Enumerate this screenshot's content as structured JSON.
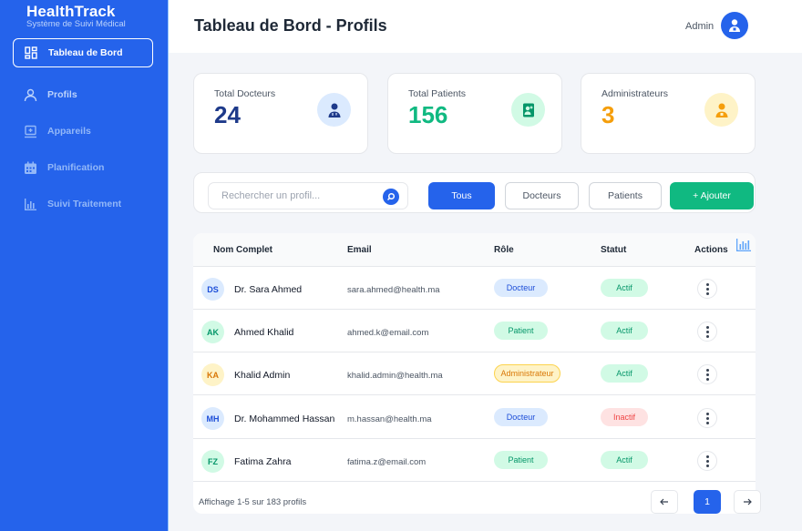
{
  "brand": {
    "title": "HealthTrack",
    "subtitle": "Système de Suivi Médical"
  },
  "sidebar": {
    "items": [
      {
        "label": "Tableau de Bord",
        "icon": "dashboard-icon",
        "active": true
      },
      {
        "label": "Profils",
        "icon": "user-icon"
      },
      {
        "label": "Appareils",
        "icon": "device-icon"
      },
      {
        "label": "Planification",
        "icon": "calendar-icon"
      },
      {
        "label": "Suivi Traitement",
        "icon": "chart-icon"
      }
    ]
  },
  "header": {
    "title": "Tableau de Bord - Profils",
    "user_label": "Admin"
  },
  "stats": [
    {
      "label": "Total Docteurs",
      "value": "24",
      "color": "#1e3a8a",
      "icon": "doctor-icon"
    },
    {
      "label": "Total Patients",
      "value": "156",
      "color": "#10b981",
      "icon": "patient-icon"
    },
    {
      "label": "Administrateurs",
      "value": "3",
      "color": "#f59e0b",
      "icon": "admin-icon"
    }
  ],
  "filters": {
    "search_placeholder": "Rechercher un profil...",
    "buttons": [
      "Tous",
      "Docteurs",
      "Patients"
    ],
    "add_label": "+ Ajouter"
  },
  "table": {
    "headers": [
      "Nom Complet",
      "Email",
      "Rôle",
      "Statut",
      "Actions"
    ],
    "rows": [
      {
        "initials": "DS",
        "name": "Dr. Sara Ahmed",
        "email": "sara.ahmed@health.ma",
        "role": "Docteur",
        "status": "Actif"
      },
      {
        "initials": "AK",
        "name": "Ahmed Khalid",
        "email": "ahmed.k@email.com",
        "role": "Patient",
        "status": "Actif"
      },
      {
        "initials": "KA",
        "name": "Khalid Admin",
        "email": "khalid.admin@health.ma",
        "role": "Administrateur",
        "status": "Actif"
      },
      {
        "initials": "MH",
        "name": "Dr. Mohammed Hassan",
        "email": "m.hassan@health.ma",
        "role": "Docteur",
        "status": "Inactif"
      },
      {
        "initials": "FZ",
        "name": "Fatima Zahra",
        "email": "fatima.z@email.com",
        "role": "Patient",
        "status": "Actif"
      }
    ],
    "footer": "Affichage 1-5 sur 183 profils",
    "current_page": "1"
  },
  "colors": {
    "primary": "#2563eb",
    "success": "#10b981",
    "warning": "#f59e0b",
    "danger": "#ef4444"
  }
}
